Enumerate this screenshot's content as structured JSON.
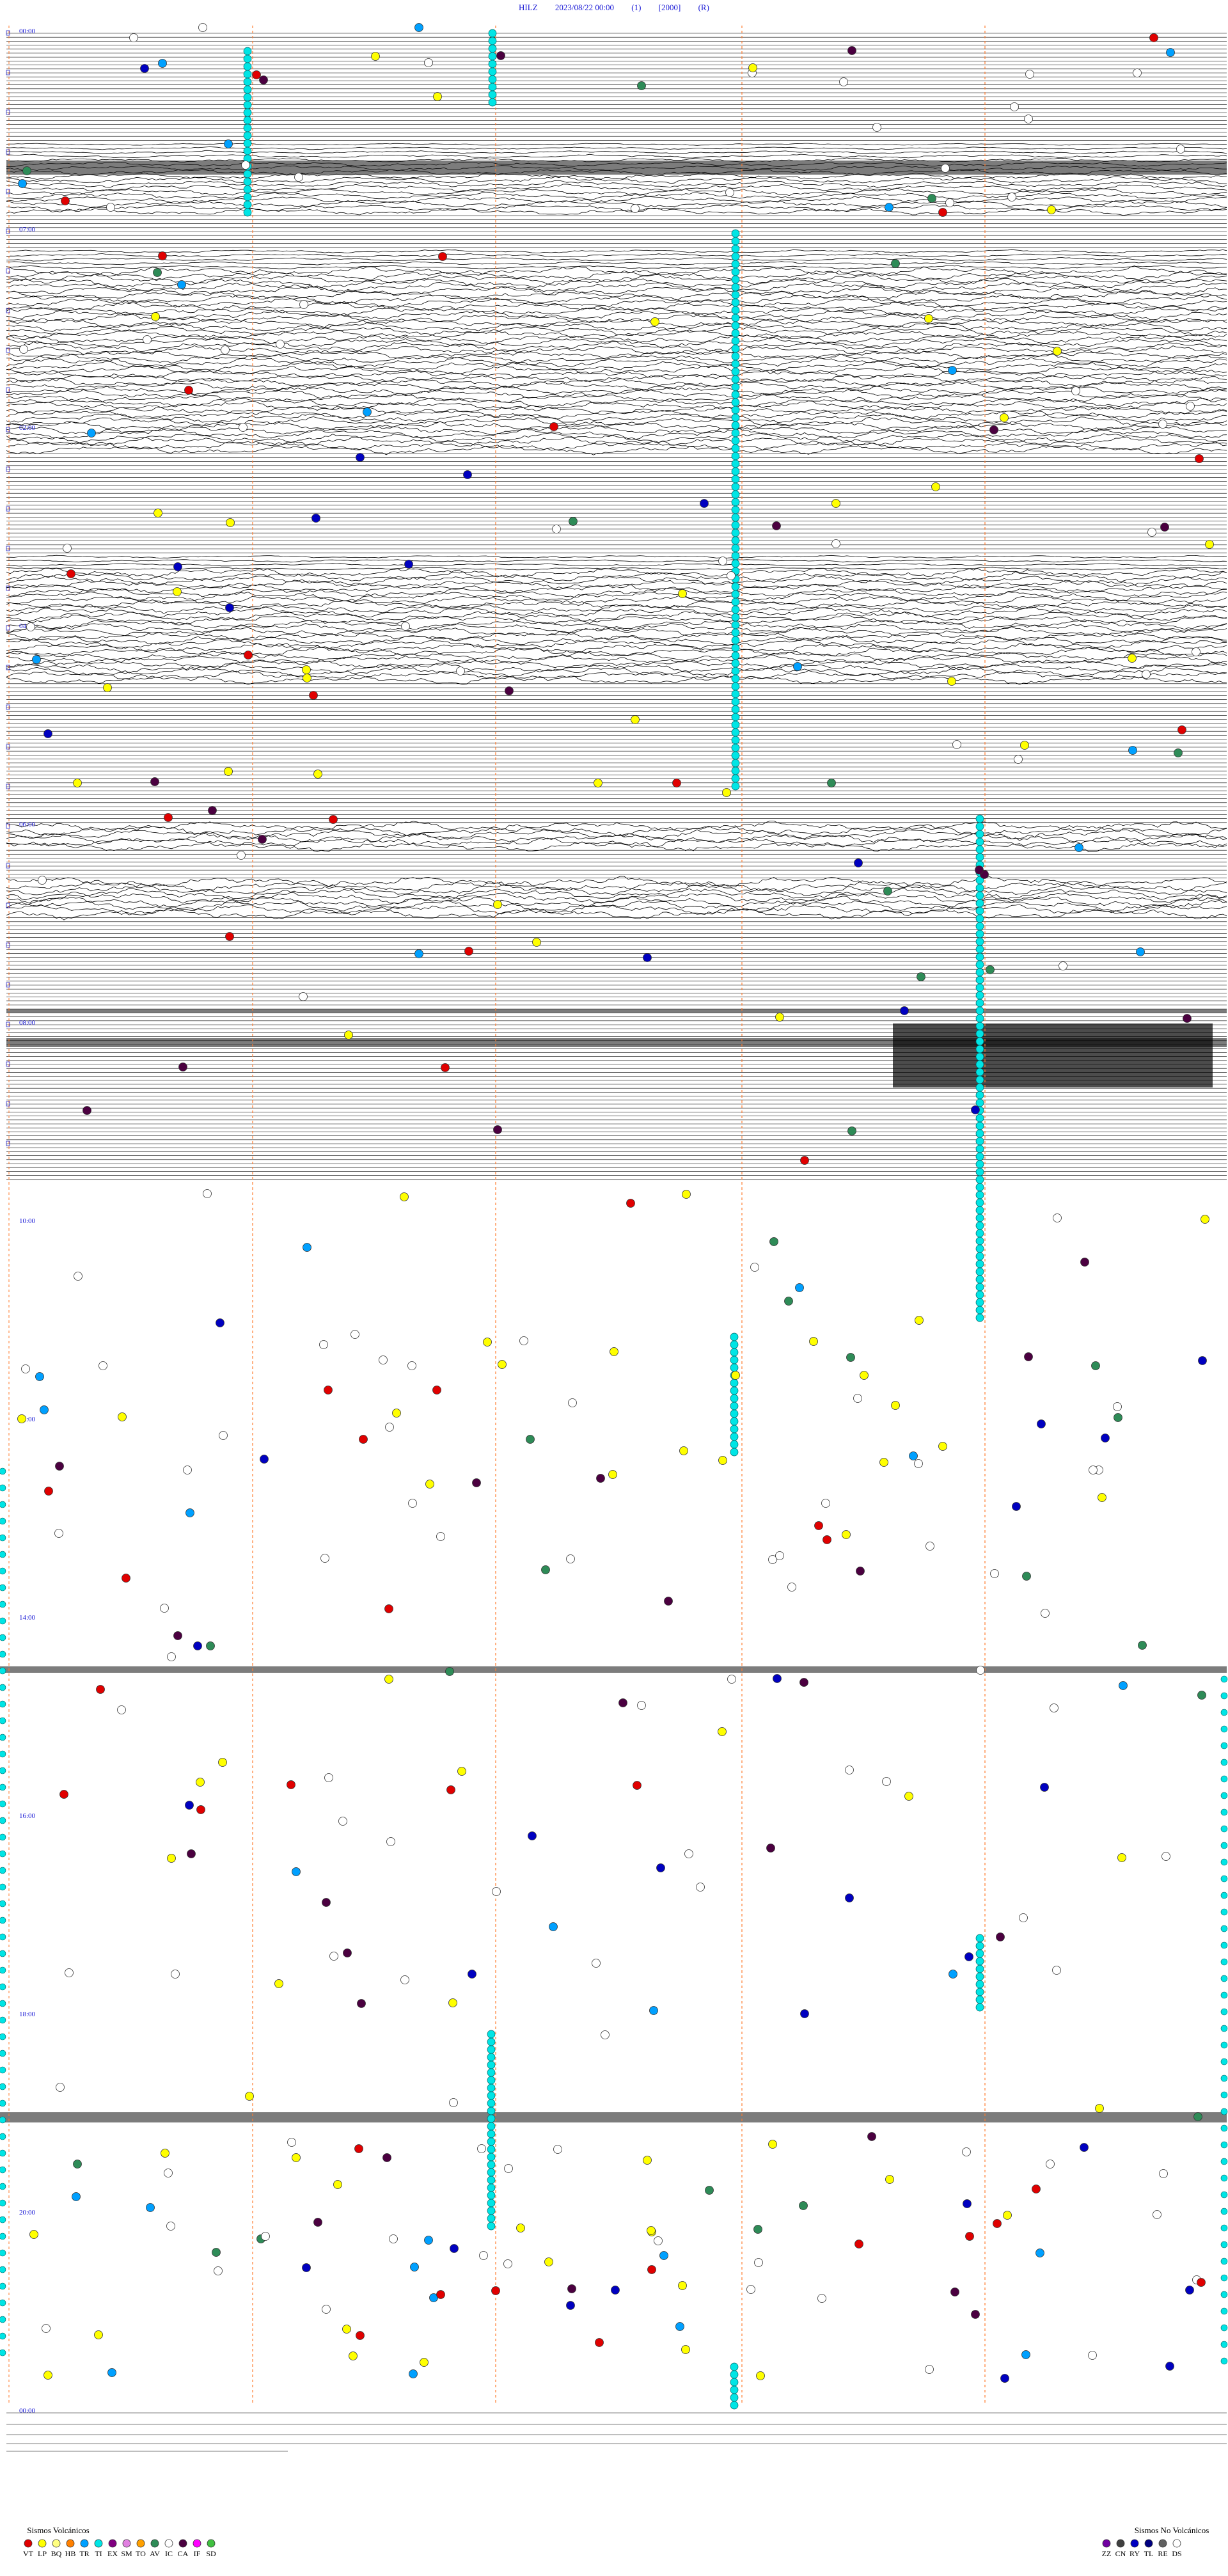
{
  "header": {
    "station": "HILZ",
    "datetime": "2023/08/22 00:00",
    "field1": "(1)",
    "field2": "[2000]",
    "field3": "(R)"
  },
  "chart_data": {
    "type": "helicorder",
    "hour_labels": [
      "00:00",
      "07:00",
      "01:00",
      "02:00",
      "03:00",
      "04:00",
      "05:00",
      "06:00",
      "07:00",
      "08:00",
      "09:00",
      "10:00",
      "11:00",
      "12:00",
      "13:00",
      "14:00",
      "15:00",
      "16:00",
      "17:00",
      "18:00",
      "19:00",
      "20:00",
      "21:00",
      "22:00",
      "23:00",
      "00:00"
    ],
    "legend_volcanic": {
      "title": "Sismos Volcánicos",
      "items": [
        {
          "code": "VT",
          "color": "#e00000"
        },
        {
          "code": "LP",
          "color": "#ffff00"
        },
        {
          "code": "BQ",
          "color": "#ffff80"
        },
        {
          "code": "HB",
          "color": "#ff8000"
        },
        {
          "code": "TR",
          "color": "#00a0ff"
        },
        {
          "code": "TI",
          "color": "#00e5e5"
        },
        {
          "code": "EX",
          "color": "#800080"
        },
        {
          "code": "SM",
          "color": "#e080e0"
        },
        {
          "code": "TO",
          "color": "#ffa000"
        },
        {
          "code": "AV",
          "color": "#2e8b57"
        },
        {
          "code": "IC",
          "color": "#ffffff"
        },
        {
          "code": "CA",
          "color": "#4b0040"
        },
        {
          "code": "IF",
          "color": "#ff00ff"
        },
        {
          "code": "SD",
          "color": "#40c040"
        }
      ]
    },
    "legend_nonvolcanic": {
      "title": "Sismos No Volcánicos",
      "items": [
        {
          "code": "ZZ",
          "color": "#7000a0"
        },
        {
          "code": "CN",
          "color": "#404040"
        },
        {
          "code": "RY",
          "color": "#0000c0"
        },
        {
          "code": "TL",
          "color": "#000080"
        },
        {
          "code": "RE",
          "color": "#606060"
        },
        {
          "code": "DS",
          "color": "#ffffff"
        }
      ]
    }
  }
}
